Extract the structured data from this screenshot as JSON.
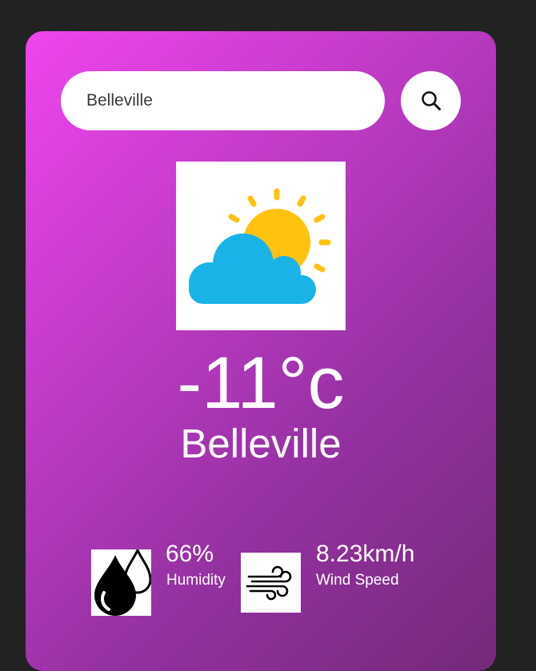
{
  "search": {
    "value": "Belleville",
    "icon": "search-icon"
  },
  "weather": {
    "icon": "partly-cloudy-icon",
    "temperature": "-11°c",
    "city": "Belleville"
  },
  "humidity": {
    "icon": "humidity-drops-icon",
    "value": "66%",
    "label": "Humidity"
  },
  "wind": {
    "icon": "wind-icon",
    "value": "8.23km/h",
    "label": "Wind Speed"
  },
  "colors": {
    "page_background": "#222222",
    "card_gradient_start": "#f044ee",
    "card_gradient_end": "#742a78",
    "sun": "#ffc20e",
    "cloud": "#1ab3e8"
  }
}
